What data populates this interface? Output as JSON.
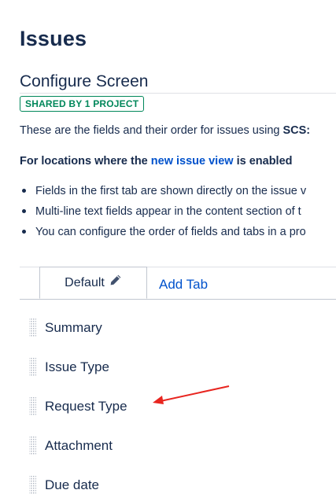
{
  "page": {
    "title": "Issues",
    "subtitle": "Configure Screen",
    "shared_badge": "SHARED BY 1 PROJECT",
    "description_prefix": "These are the fields and their order for issues using ",
    "description_bold": "SCS:"
  },
  "locations_heading": {
    "prefix": "For locations where the ",
    "link": "new issue view",
    "suffix": " is enabled"
  },
  "bullets": [
    "Fields in the first tab are shown directly on the issue v",
    "Multi-line text fields appear in the content section of t",
    "You can configure the order of fields and tabs in a pro"
  ],
  "tabs": {
    "active_label": "Default",
    "add_label": "Add Tab"
  },
  "fields": [
    "Summary",
    "Issue Type",
    "Request Type",
    "Attachment",
    "Due date"
  ],
  "icons": {
    "tab_edit": "pencil-icon",
    "drag": "drag-handle-icon",
    "annotation": "red-arrow-annotation"
  },
  "colors": {
    "text": "#172b4d",
    "link": "#0052cc",
    "badge": "#00875a",
    "annotation": "#e8251f"
  }
}
